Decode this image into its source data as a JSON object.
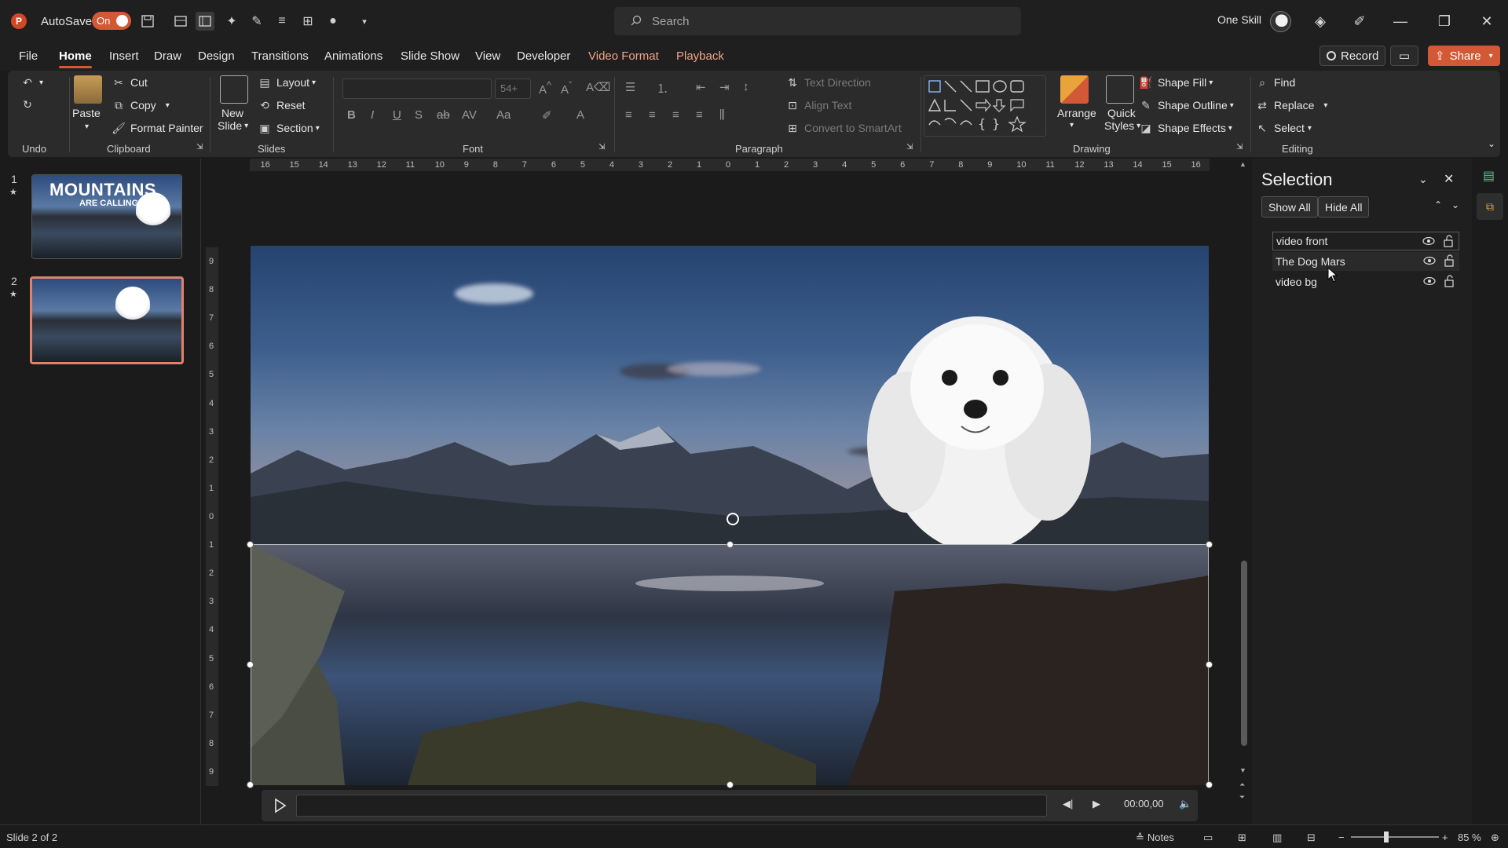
{
  "titlebar": {
    "autosave_label": "AutoSave",
    "autosave_state": "On",
    "search_placeholder": "Search",
    "account_name": "One Skill",
    "app_logo": "P"
  },
  "menu": {
    "tabs": [
      "File",
      "Home",
      "Insert",
      "Draw",
      "Design",
      "Transitions",
      "Animations",
      "Slide Show",
      "View",
      "Developer",
      "Video Format",
      "Playback"
    ],
    "active_tab": "Home",
    "record_label": "Record",
    "share_label": "Share"
  },
  "ribbon": {
    "undo_group": "Undo",
    "clipboard": {
      "paste": "Paste",
      "cut": "Cut",
      "copy": "Copy",
      "format_painter": "Format Painter",
      "label": "Clipboard"
    },
    "slides": {
      "new_slide": "New",
      "new_slide_2": "Slide",
      "layout": "Layout",
      "reset": "Reset",
      "section": "Section",
      "label": "Slides"
    },
    "font": {
      "size": "54+",
      "label": "Font"
    },
    "paragraph": {
      "text_direction": "Text Direction",
      "align_text": "Align Text",
      "convert_smartart": "Convert to SmartArt",
      "label": "Paragraph"
    },
    "drawing": {
      "arrange": "Arrange",
      "quick_styles_1": "Quick",
      "quick_styles_2": "Styles",
      "shape_fill": "Shape Fill",
      "shape_outline": "Shape Outline",
      "shape_effects": "Shape Effects",
      "label": "Drawing"
    },
    "editing": {
      "find": "Find",
      "replace": "Replace",
      "select": "Select",
      "label": "Editing"
    }
  },
  "slides_pane": {
    "slides": [
      {
        "number": "1",
        "title": "MOUNTAINS",
        "subtitle": "ARE CALLING"
      },
      {
        "number": "2"
      }
    ],
    "selected": 2
  },
  "rulers": {
    "horizontal": [
      "16",
      "15",
      "14",
      "13",
      "12",
      "11",
      "10",
      "9",
      "8",
      "7",
      "6",
      "5",
      "4",
      "3",
      "2",
      "1",
      "0",
      "1",
      "2",
      "3",
      "4",
      "5",
      "6",
      "7",
      "8",
      "9",
      "10",
      "11",
      "12",
      "13",
      "14",
      "15",
      "16"
    ],
    "vertical": [
      "9",
      "8",
      "7",
      "6",
      "5",
      "4",
      "3",
      "2",
      "1",
      "0",
      "1",
      "2",
      "3",
      "4",
      "5",
      "6",
      "7",
      "8",
      "9"
    ]
  },
  "media": {
    "time": "00:00,00"
  },
  "selection_pane": {
    "title": "Selection",
    "show_all": "Show All",
    "hide_all": "Hide All",
    "items": [
      "video front",
      "The Dog Mars",
      "video bg"
    ]
  },
  "statusbar": {
    "slide_info": "Slide 2 of 2",
    "notes": "Notes",
    "zoom": "85 %"
  },
  "colors": {
    "accent": "#d25836",
    "thumb_selected": "#e0826a",
    "background": "#1b1b1b",
    "ribbon": "#2b2b2b"
  }
}
